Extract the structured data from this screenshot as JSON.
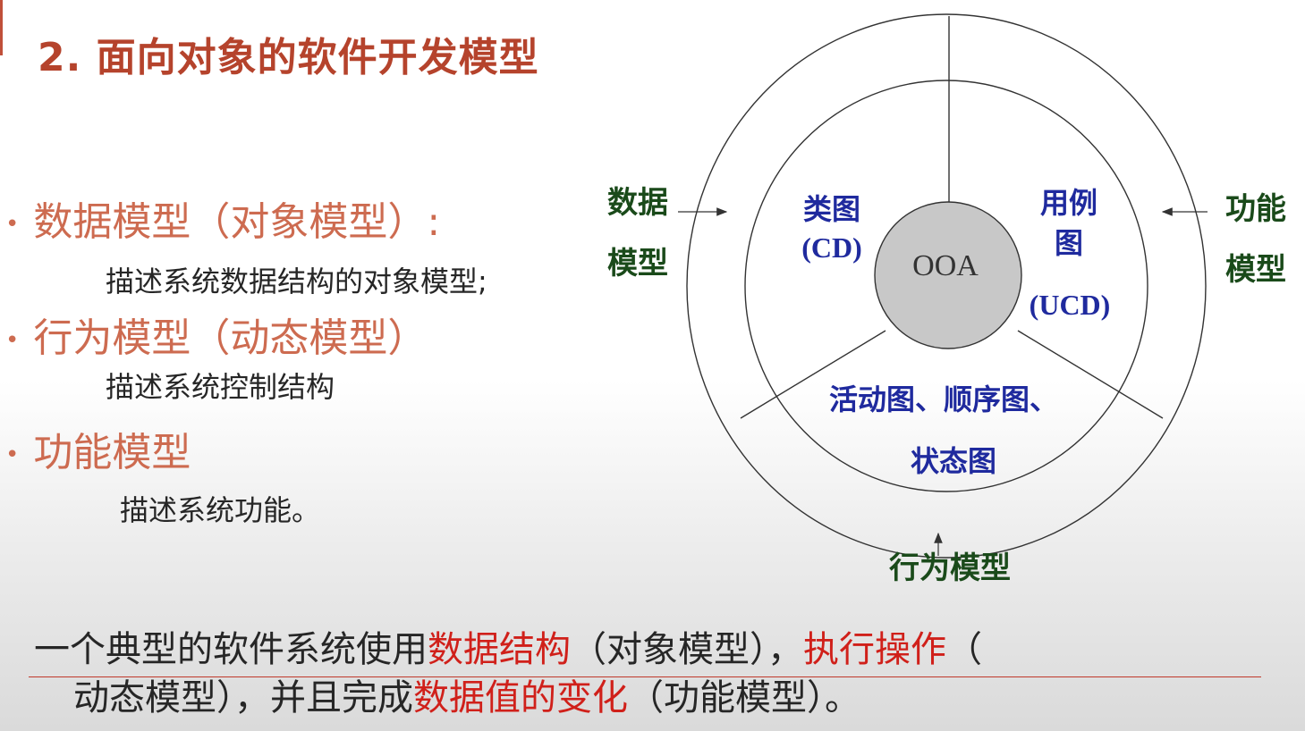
{
  "title": "2. 面向对象的软件开发模型",
  "bullets": [
    {
      "label": "数据模型（对象模型）:",
      "desc": "描述系统数据结构的对象模型;"
    },
    {
      "label": "行为模型（动态模型）",
      "desc": "描述系统控制结构"
    },
    {
      "label": "功能模型",
      "desc": "描述系统功能。"
    }
  ],
  "bullet_glyph": "•",
  "diagram": {
    "center": "OOA",
    "class_diagram": [
      "类图",
      "(CD)"
    ],
    "use_case": [
      "用例",
      "图",
      "(UCD)"
    ],
    "behavior_diagrams": [
      "活动图、顺序图、",
      "状态图"
    ],
    "left_label": [
      "数据",
      "模型"
    ],
    "right_label": [
      "功能",
      "模型"
    ],
    "bottom_label": "行为模型"
  },
  "summary": {
    "line1": {
      "p1": "一个典型的软件系统使用",
      "h1": "数据结构",
      "p2": "（对象模型），",
      "h2": "执行操作",
      "p3": "（"
    },
    "line2": {
      "p1": "动态模型），并且完成",
      "h1": "数据值的变化",
      "p2": "（功能模型）。"
    }
  },
  "colors": {
    "title": "#b5432c",
    "bullet": "#cd6b50",
    "diagram_blue": "#1f2a9e",
    "diagram_green": "#1a4a1a",
    "highlight_red": "#d0201a",
    "center_fill": "#c8c8c8"
  }
}
